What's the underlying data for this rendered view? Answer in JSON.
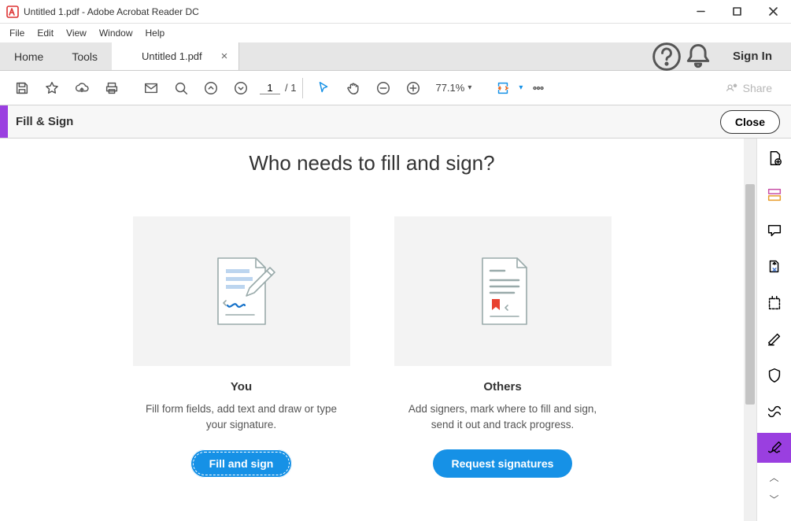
{
  "window": {
    "title": "Untitled 1.pdf - Adobe Acrobat Reader DC"
  },
  "menu": {
    "file": "File",
    "edit": "Edit",
    "view": "View",
    "window": "Window",
    "help": "Help"
  },
  "tabs": {
    "home": "Home",
    "tools": "Tools",
    "doc": "Untitled 1.pdf",
    "signin": "Sign In"
  },
  "toolbar": {
    "page_current": "1",
    "page_total": "/ 1",
    "zoom": "77.1%",
    "share": "Share"
  },
  "fsbar": {
    "title": "Fill & Sign",
    "close": "Close"
  },
  "main": {
    "heading": "Who needs to fill and sign?",
    "cards": [
      {
        "title": "You",
        "desc": "Fill form fields, add text and draw or type your signature.",
        "cta": "Fill and sign"
      },
      {
        "title": "Others",
        "desc": "Add signers, mark where to fill and sign, send it out and track progress.",
        "cta": "Request signatures"
      }
    ]
  }
}
